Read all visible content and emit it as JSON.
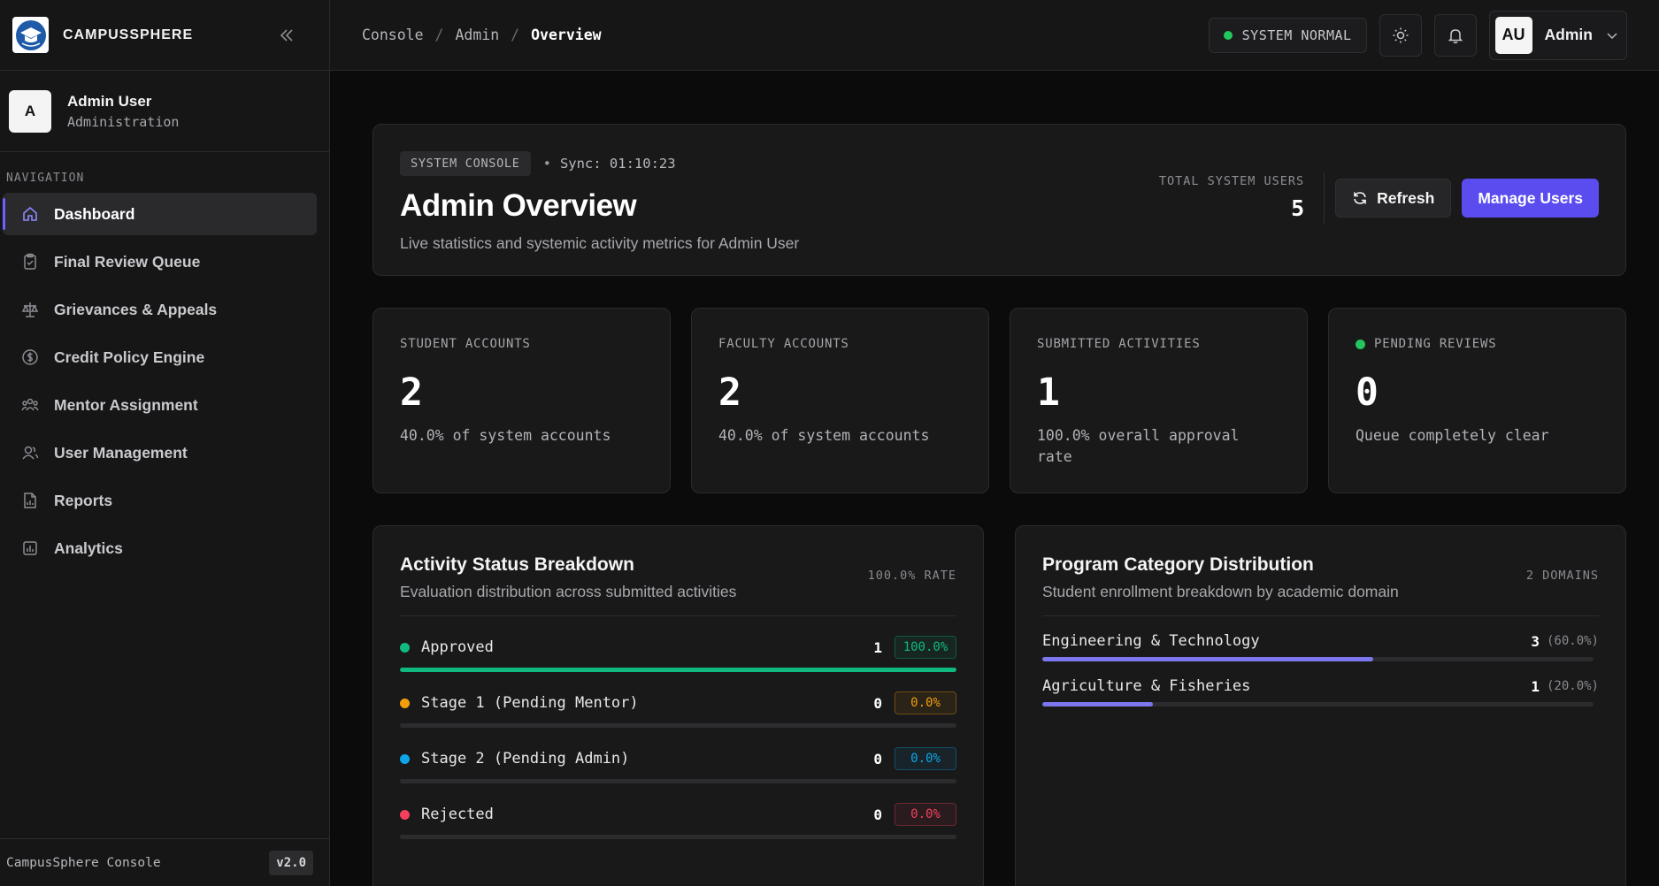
{
  "brand": {
    "name": "CAMPUSSPHERE"
  },
  "profile": {
    "initial": "A",
    "name": "Admin User",
    "role": "Administration"
  },
  "nav": {
    "label": "NAVIGATION",
    "items": [
      {
        "label": "Dashboard",
        "icon": "home-icon",
        "active": true
      },
      {
        "label": "Final Review Queue",
        "icon": "clipboard-check-icon"
      },
      {
        "label": "Grievances & Appeals",
        "icon": "scale-icon"
      },
      {
        "label": "Credit Policy Engine",
        "icon": "dollar-circle-icon"
      },
      {
        "label": "Mentor Assignment",
        "icon": "people-group-icon"
      },
      {
        "label": "User Management",
        "icon": "users-icon"
      },
      {
        "label": "Reports",
        "icon": "file-chart-icon"
      },
      {
        "label": "Analytics",
        "icon": "bar-chart-icon"
      }
    ]
  },
  "footer": {
    "text": "CampusSphere Console",
    "version": "v2.0"
  },
  "breadcrumb": [
    "Console",
    "Admin",
    "Overview"
  ],
  "topbar": {
    "status": "SYSTEM NORMAL",
    "user_initials": "AU",
    "user_name": "Admin"
  },
  "hero": {
    "badge": "SYSTEM CONSOLE",
    "sync": "Sync: 01:10:23",
    "title": "Admin Overview",
    "subtitle": "Live statistics and systemic activity metrics for Admin User",
    "total_label": "TOTAL SYSTEM USERS",
    "total_value": "5",
    "refresh_label": "Refresh",
    "manage_label": "Manage Users"
  },
  "stats": [
    {
      "label": "STUDENT ACCOUNTS",
      "value": "2",
      "note": "40.0% of system accounts"
    },
    {
      "label": "FACULTY ACCOUNTS",
      "value": "2",
      "note": "40.0% of system accounts"
    },
    {
      "label": "SUBMITTED ACTIVITIES",
      "value": "1",
      "note": "100.0% overall approval rate"
    },
    {
      "label": "PENDING REVIEWS",
      "value": "0",
      "note": "Queue completely clear"
    }
  ],
  "activity": {
    "title": "Activity Status Breakdown",
    "subtitle": "Evaluation distribution across submitted activities",
    "meta": "100.0% RATE",
    "rows": [
      {
        "label": "Approved",
        "count": "1",
        "pct": "100.0%",
        "fraction": 1.0,
        "color": "#10b981"
      },
      {
        "label": "Stage 1 (Pending Mentor)",
        "count": "0",
        "pct": "0.0%",
        "fraction": 0,
        "color": "#f59e0b"
      },
      {
        "label": "Stage 2 (Pending Admin)",
        "count": "0",
        "pct": "0.0%",
        "fraction": 0,
        "color": "#0ea5e9"
      },
      {
        "label": "Rejected",
        "count": "0",
        "pct": "0.0%",
        "fraction": 0,
        "color": "#f43f5e"
      }
    ]
  },
  "programs": {
    "title": "Program Category Distribution",
    "subtitle": "Student enrollment breakdown by academic domain",
    "meta": "2 DOMAINS",
    "rows": [
      {
        "label": "Engineering & Technology",
        "count": "3",
        "pct": "(60.0%)",
        "fraction": 0.6
      },
      {
        "label": "Agriculture & Fisheries",
        "count": "1",
        "pct": "(20.0%)",
        "fraction": 0.2
      }
    ]
  },
  "colors": {
    "accent": "#5b4cf0",
    "status_ok": "#22c55e",
    "category_bar": "#7c77ee"
  }
}
